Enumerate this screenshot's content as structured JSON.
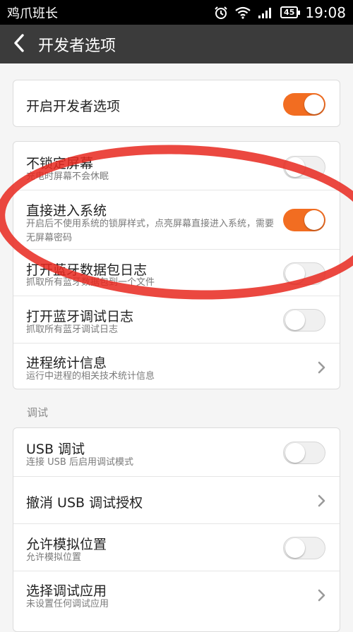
{
  "status_bar": {
    "carrier": "鸡爪班长",
    "battery": "45",
    "time": "19:08",
    "icons": [
      "alarm-icon",
      "wifi-icon",
      "signal-icon",
      "battery-icon"
    ]
  },
  "header": {
    "title": "开发者选项",
    "back_icon": "chevron-left-icon"
  },
  "group1": {
    "enable_dev": {
      "title": "开启开发者选项",
      "toggle": "on"
    }
  },
  "group2": {
    "items": [
      {
        "title": "不锁定屏幕",
        "subtitle": "充电时屏幕不会休眠",
        "control": "toggle-off"
      },
      {
        "title": "直接进入系统",
        "subtitle": "开启后不使用系统的锁屏样式，点亮屏幕直接进入系统，需要无屏幕密码",
        "control": "toggle-on"
      },
      {
        "title": "打开蓝牙数据包日志",
        "subtitle": "抓取所有蓝牙数据包到一个文件",
        "control": "toggle-off"
      },
      {
        "title": "打开蓝牙调试日志",
        "subtitle": "抓取所有蓝牙调试日志",
        "control": "toggle-off"
      },
      {
        "title": "进程统计信息",
        "subtitle": "运行中进程的相关技术统计信息",
        "control": "chevron"
      }
    ]
  },
  "section_debug": {
    "label": "调试"
  },
  "group3": {
    "items": [
      {
        "title": "USB 调试",
        "subtitle": "连接 USB 后启用调试模式",
        "control": "toggle-off"
      },
      {
        "title": "撤消 USB 调试授权",
        "subtitle": "",
        "control": "chevron"
      },
      {
        "title": "允许模拟位置",
        "subtitle": "允许模拟位置",
        "control": "toggle-off"
      },
      {
        "title": "选择调试应用",
        "subtitle": "未设置任何调试应用",
        "control": "chevron"
      }
    ]
  },
  "colors": {
    "accent": "#f26d21",
    "header_bg": "#3b3b3b",
    "annotation": "#e8281e"
  }
}
